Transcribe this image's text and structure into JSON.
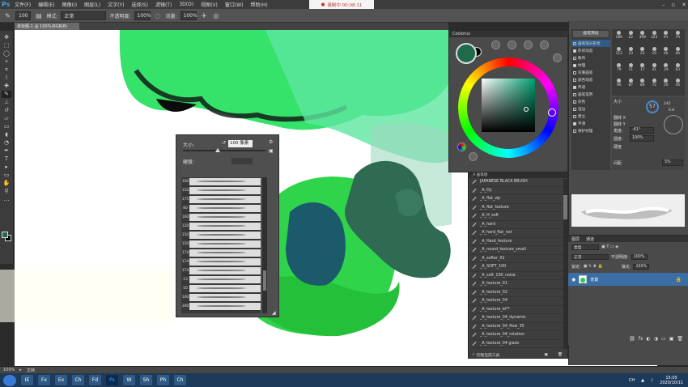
{
  "app": {
    "logo": "Ps"
  },
  "menubar": {
    "items": [
      "文件(F)",
      "编辑(E)",
      "图像(I)",
      "图层(L)",
      "文字(Y)",
      "选择(S)",
      "滤镜(T)",
      "3D(D)",
      "视图(V)",
      "窗口(W)",
      "帮助(H)"
    ],
    "recording": "录制中 00:08:11"
  },
  "options": {
    "brush_size": "100",
    "mode_label": "模式:",
    "mode_value": "正常",
    "opacity_label": "不透明度:",
    "opacity_value": "100%",
    "flow_label": "流量:",
    "flow_value": "100%"
  },
  "document": {
    "tab_title": "未标题-1 @ 100%(RGB/8)"
  },
  "brush_popup": {
    "size_label": "大小:",
    "size_value": "100 像素",
    "hardness_label": "硬度:",
    "brushes": [
      {
        "num": "100"
      },
      {
        "num": "150"
      },
      {
        "num": "175"
      },
      {
        "num": "80"
      },
      {
        "num": "160"
      },
      {
        "num": "120"
      },
      {
        "num": "150"
      },
      {
        "num": "150"
      },
      {
        "num": "174"
      },
      {
        "num": "174"
      },
      {
        "num": "174"
      },
      {
        "num": "13"
      },
      {
        "num": "50"
      },
      {
        "num": "100"
      },
      {
        "num": "300"
      }
    ]
  },
  "color_panel": {
    "title": "Coolorus",
    "current_color": "#1e6b4c"
  },
  "brush_library": {
    "title": "_A 画笔组",
    "items": [
      "JAPANESE BLACK BRUSH",
      "_A_Dy",
      "_A_flat_zip",
      "_A_flat_texture",
      "_A_H_soft",
      "_A_hard",
      "_A_hard_flat_not",
      "_A_Hard_texture",
      "_A_round_texture_small",
      "_A_softer_02",
      "_A_SOFT_100",
      "_A_soft_100_noise",
      "_A_texture_01",
      "_A_texture_02",
      "_A_texture_04",
      "_A_texture_bl**",
      "_A_texture_04_dynamic",
      "_A_texture_04_flow_35",
      "_A_texture_04_rotation",
      "_A_texture_04 glaze"
    ],
    "footer": "仅限当前工具"
  },
  "brush_settings": {
    "preset_button": "画笔预设",
    "items": [
      {
        "label": "画笔笔尖形状",
        "checked": false,
        "selected": true
      },
      {
        "label": "形状动态",
        "checked": true,
        "selected": false
      },
      {
        "label": "散布",
        "checked": false,
        "selected": false
      },
      {
        "label": "纹理",
        "checked": true,
        "selected": false
      },
      {
        "label": "双重画笔",
        "checked": false,
        "selected": false
      },
      {
        "label": "颜色动态",
        "checked": false,
        "selected": false
      },
      {
        "label": "传递",
        "checked": true,
        "selected": false
      },
      {
        "label": "画笔笔势",
        "checked": false,
        "selected": false
      },
      {
        "label": "杂色",
        "checked": false,
        "selected": false
      },
      {
        "label": "湿边",
        "checked": false,
        "selected": false
      },
      {
        "label": "建立",
        "checked": false,
        "selected": false
      },
      {
        "label": "平滑",
        "checked": true,
        "selected": false
      },
      {
        "label": "保护纹理",
        "checked": false,
        "selected": false
      }
    ],
    "grid": [
      "189",
      "22",
      "399",
      "325",
      "91",
      "70",
      "112",
      "23",
      "23",
      "19",
      "40",
      "46",
      "79",
      "11",
      "17",
      "41",
      "34",
      "63",
      "90",
      "87",
      "80",
      "72",
      "50",
      "44"
    ],
    "size_label": "大小",
    "size_badge": "57",
    "flip_x": "翻转 X",
    "flip_y": "翻转 Y",
    "angle_label": "角度:",
    "angle_value": "-61°",
    "roundness_label": "圆度:",
    "roundness_value": "100%",
    "hardness_label": "硬度",
    "spacing_label": "间距",
    "spacing_value": "5%",
    "dial_value1": "142",
    "dial_value2": "0.6"
  },
  "layers": {
    "tabs": [
      "图层",
      "通道"
    ],
    "kind_label": "类型",
    "blend_mode": "正常",
    "opacity_label": "不透明度:",
    "opacity_value": "100%",
    "lock_label": "锁定:",
    "fill_label": "填充:",
    "fill_value": "100%",
    "layer_name": "背景"
  },
  "status": {
    "zoom": "100%",
    "doc_info": "文档"
  },
  "taskbar": {
    "apps": [
      "IE",
      "Fx",
      "Ex",
      "Ch",
      "Fd",
      "Ps",
      "W",
      "Sh",
      "Ph",
      "Ch"
    ],
    "lang": "CH",
    "time": "15:05",
    "date": "2020/10/11"
  }
}
